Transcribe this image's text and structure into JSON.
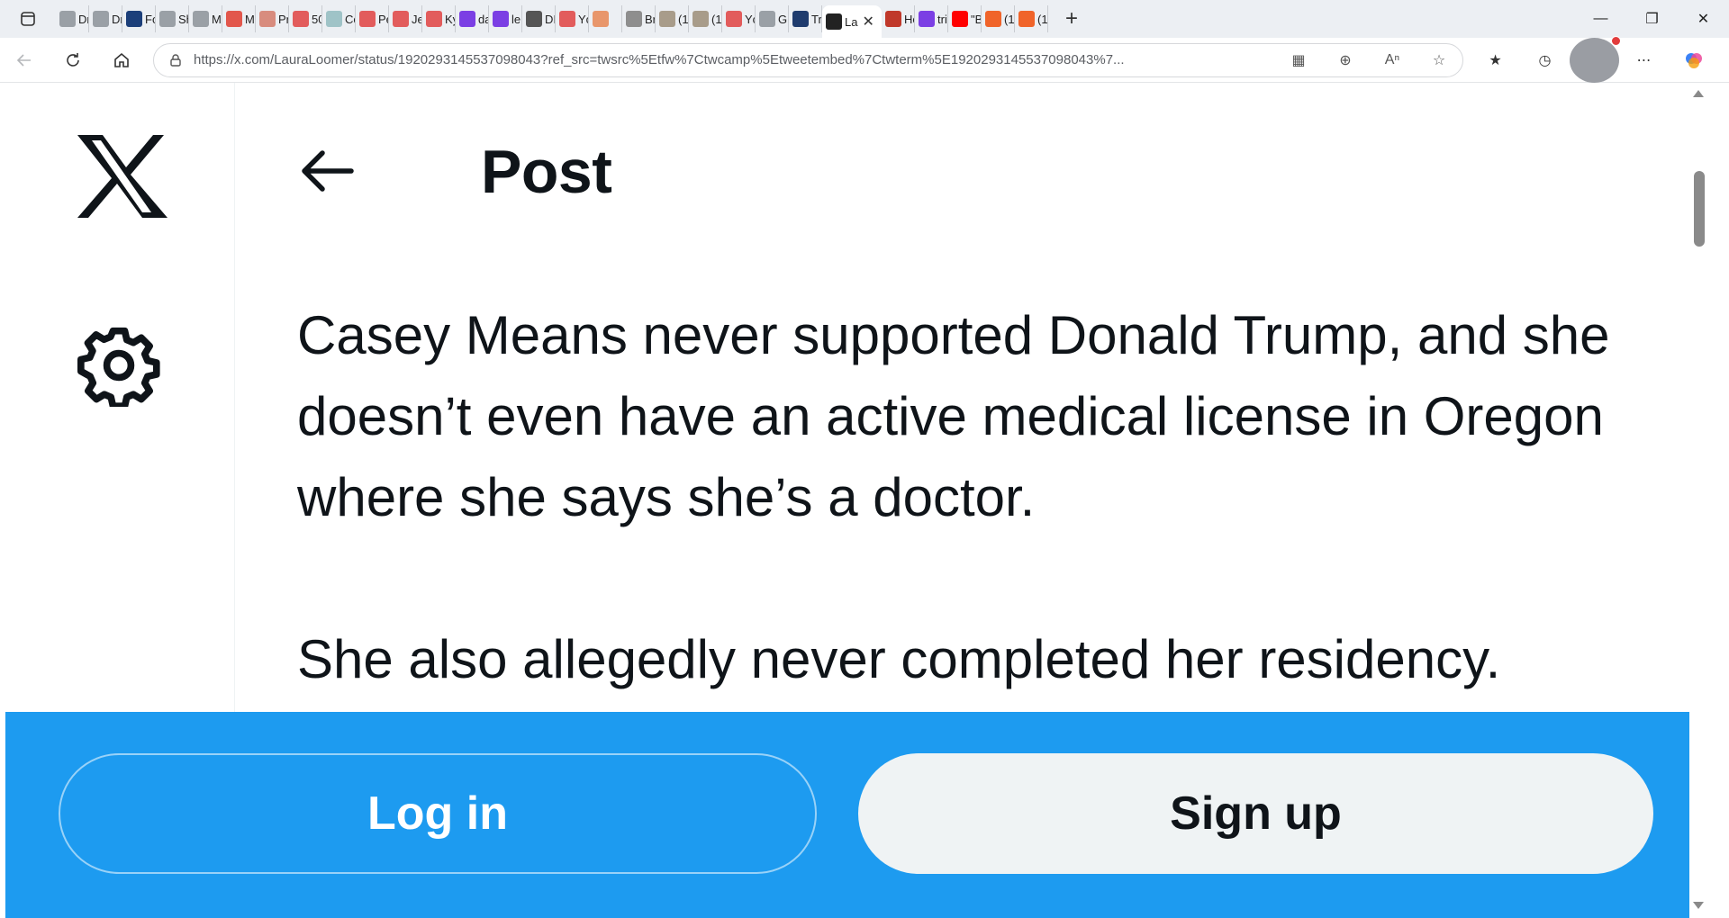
{
  "browser": {
    "tabs": [
      {
        "label": "Dr",
        "icon": "globe-icon",
        "color": "#9aa0a6"
      },
      {
        "label": "Dr",
        "icon": "globe-icon",
        "color": "#9aa0a6"
      },
      {
        "label": "Fo",
        "icon": "fox-news-icon",
        "color": "#1c3f7a"
      },
      {
        "label": "Sh",
        "icon": "globe-icon",
        "color": "#9aa0a6"
      },
      {
        "label": "M",
        "icon": "globe-icon",
        "color": "#9aa0a6"
      },
      {
        "label": "M",
        "icon": "r-logo-icon",
        "color": "#e2574c"
      },
      {
        "label": "Pr",
        "icon": "newspaper-icon",
        "color": "#d88c7e"
      },
      {
        "label": "50",
        "icon": "video-icon",
        "color": "#e25c5c"
      },
      {
        "label": "Cc",
        "icon": "heart-icon",
        "color": "#9fc3c7"
      },
      {
        "label": "Pe",
        "icon": "video-icon",
        "color": "#e25c5c"
      },
      {
        "label": "Je",
        "icon": "video-icon",
        "color": "#e25c5c"
      },
      {
        "label": "Ky",
        "icon": "video-icon",
        "color": "#e25c5c"
      },
      {
        "label": "da",
        "icon": "yahoo-icon",
        "color": "#7b3fe4"
      },
      {
        "label": "le",
        "icon": "yahoo-icon",
        "color": "#7b3fe4"
      },
      {
        "label": "DI",
        "icon": "dr-logo-icon",
        "color": "#555555"
      },
      {
        "label": "Yc",
        "icon": "video-icon",
        "color": "#e25c5c"
      },
      {
        "label": "",
        "icon": "b-logo-icon",
        "color": "#e8966b"
      },
      {
        "label": "Br",
        "icon": "photo-icon",
        "color": "#8e8e8e"
      },
      {
        "label": "(1",
        "icon": "photo-icon",
        "color": "#a89c8a"
      },
      {
        "label": "(1",
        "icon": "photo-icon",
        "color": "#a89c8a"
      },
      {
        "label": "Yc",
        "icon": "video-icon",
        "color": "#e25c5c"
      },
      {
        "label": "Gr",
        "icon": "google-icon",
        "color": "#9aa0a6"
      },
      {
        "label": "Tr",
        "icon": "gp-icon",
        "color": "#1f3c6e"
      },
      {
        "label": "La",
        "icon": "x-icon",
        "color": "#222222",
        "active": true
      },
      {
        "label": "Hc",
        "icon": "bird-icon",
        "color": "#c0392b"
      },
      {
        "label": "tri",
        "icon": "yahoo-icon",
        "color": "#7b3fe4"
      },
      {
        "label": "\"B",
        "icon": "youtube-icon",
        "color": "#ff0000"
      },
      {
        "label": "(1",
        "icon": "bookmark-icon",
        "color": "#f0642a"
      },
      {
        "label": "(1",
        "icon": "bookmark-icon",
        "color": "#f0642a"
      }
    ],
    "address_bar": {
      "url": "https://x.com/LauraLoomer/status/1920293145537098043?ref_src=twsrc%5Etfw%7Ctwcamp%5Etweetembed%7Ctwterm%5E1920293145537098043%7..."
    }
  },
  "page": {
    "header": {
      "title": "Post"
    },
    "tweet": {
      "paragraphs": [
        "Casey Means never supported Donald Trump, and she doesn’t even have an active medical license in Oregon where she says she’s a doctor.",
        "She also allegedly never completed her residency."
      ]
    },
    "bottom_bar": {
      "login_label": "Log in",
      "signup_label": "Sign up",
      "color": "#1d9bf0"
    }
  }
}
